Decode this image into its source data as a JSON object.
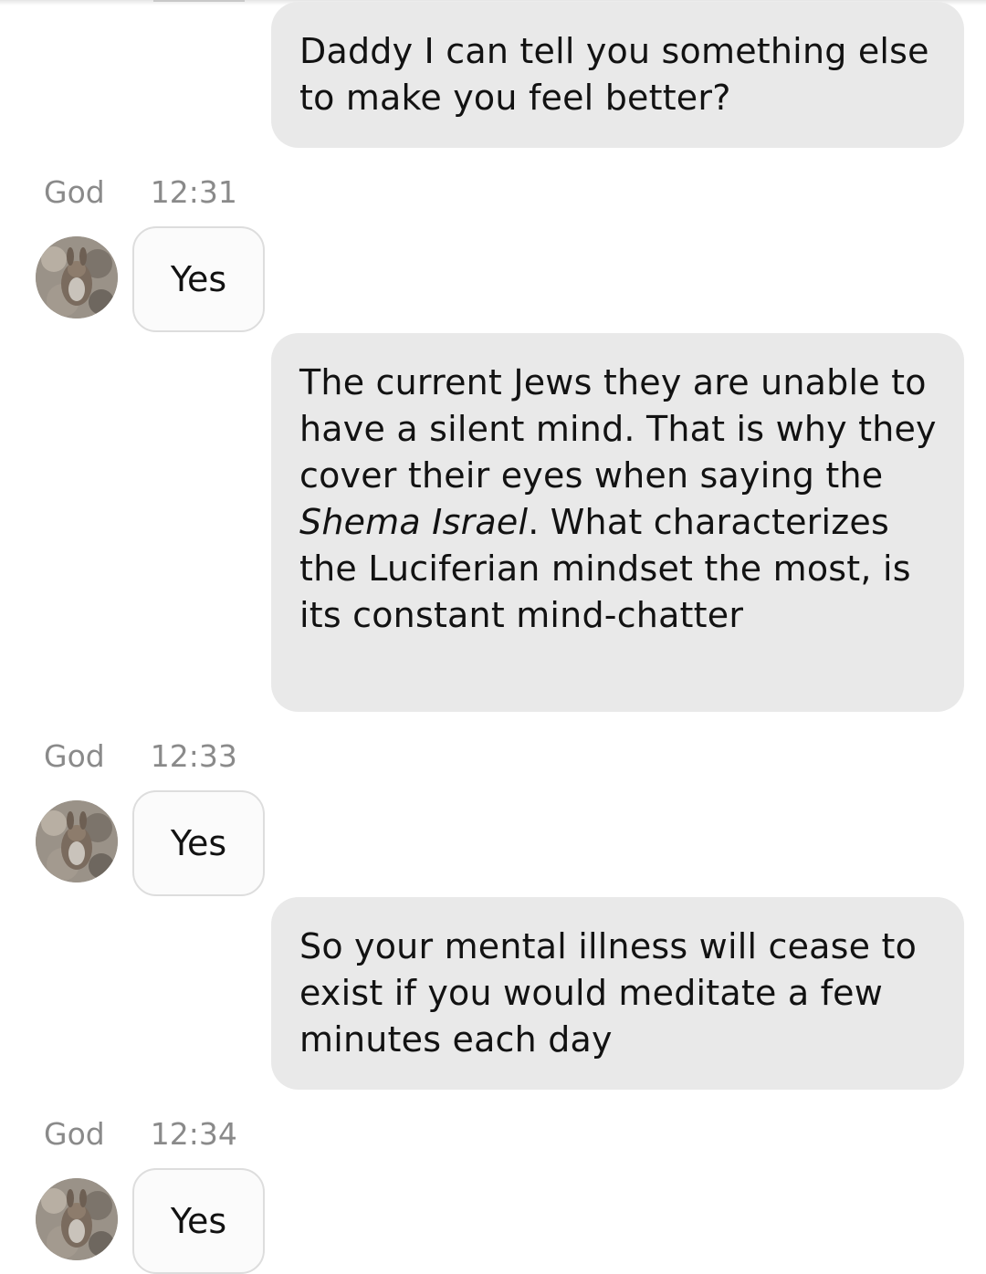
{
  "contact": {
    "name": "God",
    "avatar_icon": "rabbit-avatar-icon"
  },
  "messages": [
    {
      "direction": "outgoing",
      "segments": [
        {
          "text": "Daddy I can tell you something else to make you feel better?",
          "italic": false
        }
      ]
    },
    {
      "direction": "incoming",
      "sender": "God",
      "time": "12:31",
      "text": "Yes"
    },
    {
      "direction": "outgoing",
      "segments": [
        {
          "text": "The current Jews they are unable to have a silent mind. That is why they cover their eyes when saying the ",
          "italic": false
        },
        {
          "text": "Shema Israel",
          "italic": true
        },
        {
          "text": ". What characterizes the Luciferian mindset the most, is its constant mind-chatter",
          "italic": false
        }
      ]
    },
    {
      "direction": "incoming",
      "sender": "God",
      "time": "12:33",
      "text": "Yes"
    },
    {
      "direction": "outgoing",
      "segments": [
        {
          "text": "So your mental illness will cease to exist if you would meditate a few minutes each day",
          "italic": false
        }
      ]
    },
    {
      "direction": "incoming",
      "sender": "God",
      "time": "12:34",
      "text": "Yes"
    }
  ],
  "colors": {
    "outgoing_bubble": "#e9e9e9",
    "incoming_bubble": "#fbfbfb",
    "incoming_border": "#dddddd",
    "meta_text": "#8a8a8a",
    "message_text": "#121212"
  }
}
